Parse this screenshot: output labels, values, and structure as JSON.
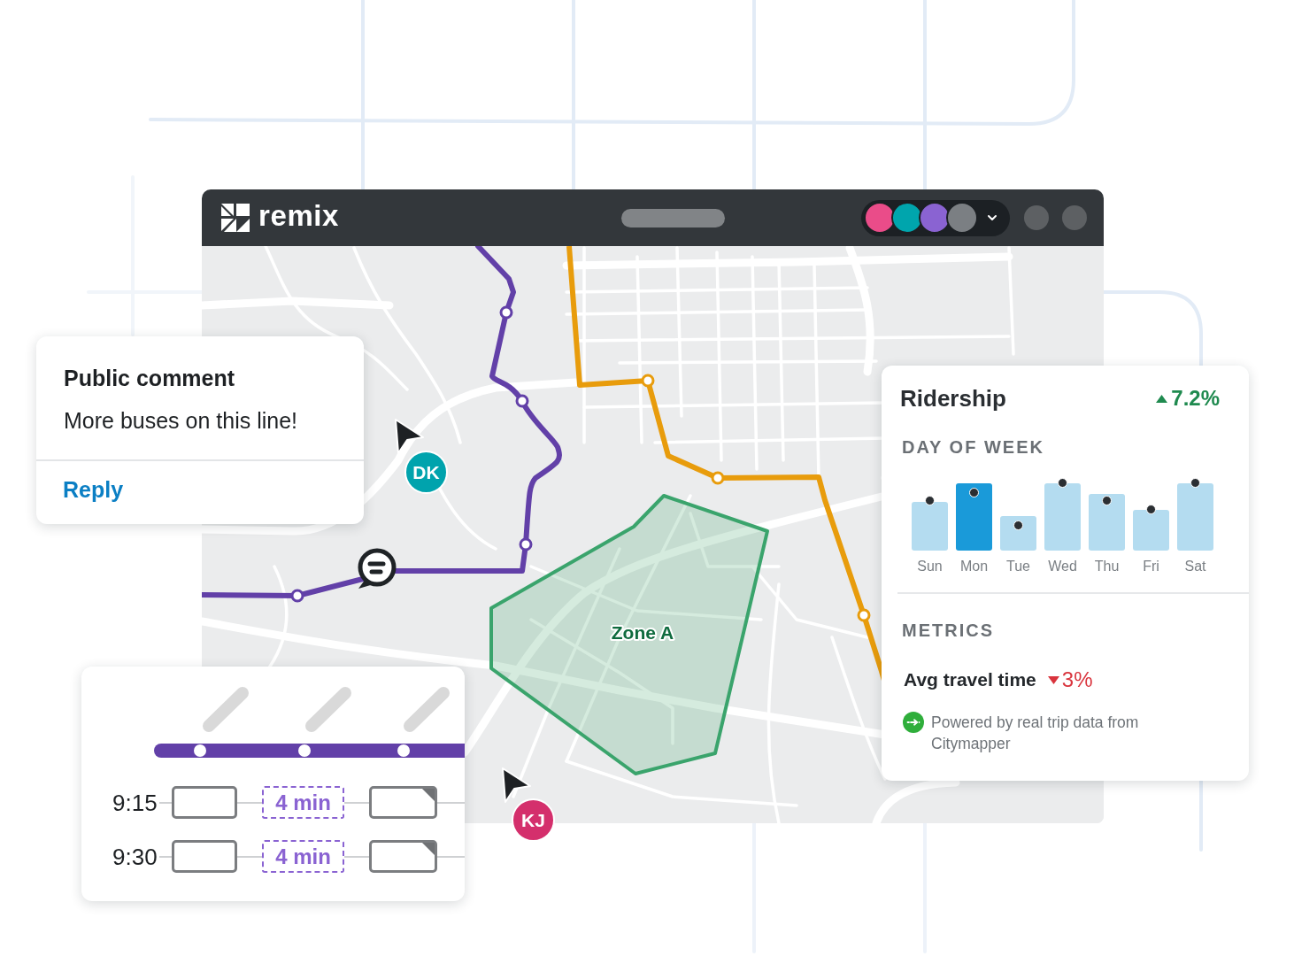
{
  "window": {
    "logo": "remix",
    "collaborators": [
      {
        "color": "#ea4c89"
      },
      {
        "color": "#00a5ad"
      },
      {
        "color": "#8a63d2"
      },
      {
        "color": "#7b7f83"
      }
    ]
  },
  "map": {
    "zone_label": "Zone A"
  },
  "cursors": [
    {
      "initials": "DK",
      "color": "#00a3ad"
    },
    {
      "initials": "KJ",
      "color": "#d42f6c"
    }
  ],
  "comment_card": {
    "title": "Public comment",
    "body": "More buses on this line!",
    "action": "Reply"
  },
  "ridership_card": {
    "title": "Ridership",
    "change": {
      "positive": true,
      "value": "7.2%"
    },
    "section": "DAY OF WEEK",
    "days": [
      {
        "label": "Sun",
        "selected": false
      },
      {
        "label": "Mon",
        "selected": true
      },
      {
        "label": "Tue",
        "selected": false
      },
      {
        "label": "Wed",
        "selected": false
      },
      {
        "label": "Thu",
        "selected": false
      },
      {
        "label": "Fri",
        "selected": false
      },
      {
        "label": "Sat",
        "selected": false
      }
    ],
    "metrics_heading": "METRICS",
    "metrics": [
      {
        "label": "Avg travel time",
        "positive": false,
        "value": "3%"
      }
    ],
    "source": "Powered by real trip data from Citymapper"
  },
  "timetable_card": {
    "rows": [
      {
        "time": "9:15",
        "cells": [
          {
            "kind": "trip"
          },
          {
            "kind": "duration",
            "text": "4 min"
          },
          {
            "kind": "flagged"
          }
        ]
      },
      {
        "time": "9:30",
        "cells": [
          {
            "kind": "trip"
          },
          {
            "kind": "duration",
            "text": "4 min"
          },
          {
            "kind": "flagged"
          }
        ]
      }
    ]
  }
}
